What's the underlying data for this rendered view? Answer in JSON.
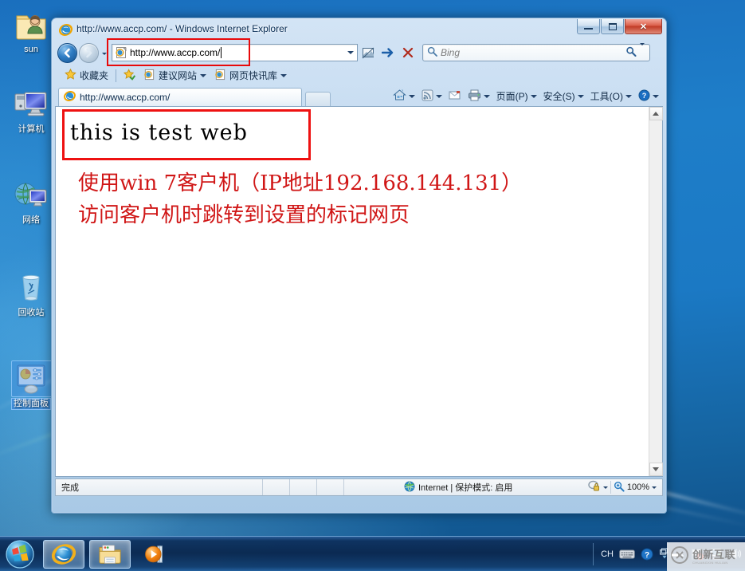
{
  "desktop": {
    "icons": [
      {
        "label": "sun",
        "icon": "user-folder-icon",
        "selected": false
      },
      {
        "label": "计算机",
        "icon": "computer-icon",
        "selected": false
      },
      {
        "label": "网络",
        "icon": "network-icon",
        "selected": false
      },
      {
        "label": "回收站",
        "icon": "recycle-bin-icon",
        "selected": false
      },
      {
        "label": "控制面板",
        "icon": "control-panel-icon",
        "selected": true
      }
    ]
  },
  "window": {
    "title": "http://www.accp.com/ - Windows Internet Explorer",
    "icon": "internet-explorer-icon",
    "buttons": {
      "minimize": "minimize-icon",
      "maximize": "maximize-icon",
      "close": "✕"
    }
  },
  "navbar": {
    "back_label": "◀",
    "forward_label": "▶",
    "history_label": "▾",
    "address": {
      "value": "http://www.accp.com/",
      "favicon": "page-icon",
      "dropdown": "chevron-down-icon",
      "highlighted": true
    },
    "compat_button": "compatibility-view-icon",
    "go_button": "➜",
    "stop_button": "✕",
    "search": {
      "placeholder": "Bing",
      "icon": "search-icon",
      "dropdown": "chevron-down-icon"
    }
  },
  "favorites_bar": {
    "favorites_label": "收藏夹",
    "star_icon": "star-icon",
    "add_icon": "add-favorite-icon",
    "items": [
      {
        "label": "建议网站",
        "icon": "ie-icon",
        "has_dropdown": true
      },
      {
        "label": "网页快讯库",
        "icon": "ie-icon",
        "has_dropdown": true
      }
    ]
  },
  "tabs": [
    {
      "label": "http://www.accp.com/",
      "icon": "ie-icon",
      "active": true
    }
  ],
  "new_tab_label": "",
  "command_bar": {
    "items": [
      {
        "label": "",
        "icon": "home-icon",
        "has_dropdown": true
      },
      {
        "label": "",
        "icon": "feeds-icon",
        "has_dropdown": true
      },
      {
        "label": "",
        "icon": "mail-icon",
        "has_dropdown": false
      },
      {
        "label": "",
        "icon": "print-icon",
        "has_dropdown": true
      },
      {
        "label": "页面(P)",
        "icon": "",
        "has_dropdown": true
      },
      {
        "label": "安全(S)",
        "icon": "",
        "has_dropdown": true
      },
      {
        "label": "工具(O)",
        "icon": "",
        "has_dropdown": true
      },
      {
        "label": "",
        "icon": "help-icon",
        "has_dropdown": true
      }
    ]
  },
  "page": {
    "heading": "this is test web",
    "annotation_line1": "使用win 7客户机（IP地址192.168.144.131）",
    "annotation_line2": "访问客户机时跳转到设置的标记网页",
    "annotation_color": "#d01616",
    "highlight_color": "#ee1111"
  },
  "scrollbar": {
    "up": "scroll-up-icon",
    "down": "scroll-down-icon"
  },
  "status_bar": {
    "text": "完成",
    "zone_icon": "internet-zone-icon",
    "zone_text": "Internet | 保护模式: 启用",
    "privacy_icon": "privacy-icon",
    "zoom_icon": "zoom-icon",
    "zoom_level": "100%",
    "dropdown": "chevron-down-icon"
  },
  "taskbar": {
    "start_label": "start-orb",
    "buttons": [
      {
        "name": "internet-explorer",
        "icon": "ie-icon",
        "active": true
      },
      {
        "name": "windows-explorer",
        "icon": "folder-icon",
        "active": true
      },
      {
        "name": "media-player",
        "icon": "media-player-icon",
        "active": false
      }
    ],
    "tray": {
      "ime_label": "CH",
      "keyboard_icon": "keyboard-icon",
      "help_icon": "help-icon",
      "show_hidden_icon": "chevron-up-icon",
      "network_icon": "network-error-icon",
      "monitor_icon": "monitor-icon",
      "volume_icon": "volume-icon"
    }
  },
  "watermark": {
    "main": "创新互联",
    "sub": "CHUANGXIN HULIAN",
    "icon": "cx-logo-icon"
  }
}
